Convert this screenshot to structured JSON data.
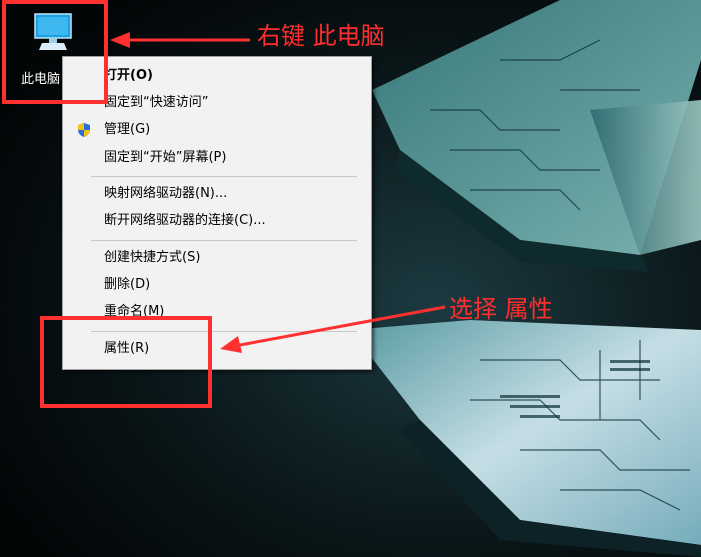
{
  "desktop": {
    "icon_label": "此电脑",
    "icon_name": "this-pc-icon"
  },
  "context_menu": {
    "items": [
      {
        "label": "打开(O)",
        "bold": true
      },
      {
        "label": "固定到“快速访问”"
      },
      {
        "label": "管理(G)",
        "icon": "uac-shield-icon"
      },
      {
        "label": "固定到“开始”屏幕(P)"
      },
      {
        "label": "映射网络驱动器(N)..."
      },
      {
        "label": "断开网络驱动器的连接(C)..."
      },
      {
        "label": "创建快捷方式(S)"
      },
      {
        "label": "删除(D)"
      },
      {
        "label": "重命名(M)"
      },
      {
        "label": "属性(R)"
      }
    ]
  },
  "annotations": {
    "step1": "右键 此电脑",
    "step2": "选择 属性",
    "color": "#ff2e2e"
  }
}
